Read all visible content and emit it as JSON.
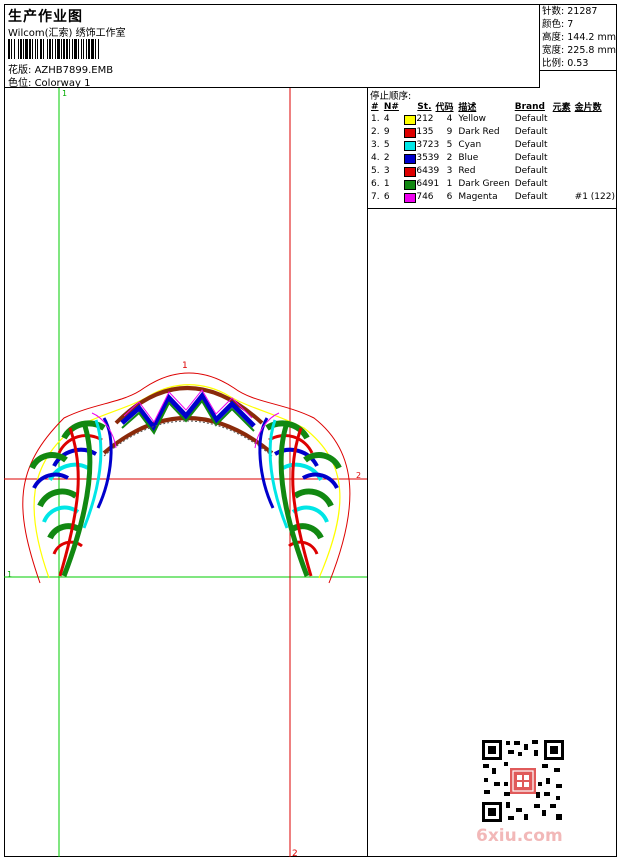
{
  "header": {
    "title": "生产作业图",
    "studio": "Wilcom(汇索) 绣饰工作室",
    "design_label": "花版:",
    "design_value": "AZHB7899.EMB",
    "colorway_label": "色位:",
    "colorway_value": "Colorway 1"
  },
  "stats": {
    "stitches_label": "针数:",
    "stitches": "21287",
    "colors_label": "颜色:",
    "colors": "7",
    "height_label": "高度:",
    "height": "144.2 mm",
    "width_label": "宽度:",
    "width": "225.8 mm",
    "scale_label": "比例:",
    "scale": "0.53"
  },
  "stop_sequence": {
    "title": "停止顺序:",
    "columns": [
      "#",
      "N#",
      "St.",
      "代码",
      "描述",
      "Brand",
      "元素",
      "金片数"
    ],
    "rows": [
      {
        "idx": "1.",
        "n": "4",
        "color": "#ffff00",
        "st": "212",
        "code": "4",
        "desc": "Yellow",
        "brand": "Default",
        "elem": "",
        "seq": ""
      },
      {
        "idx": "2.",
        "n": "9",
        "color": "#dd0000",
        "st": "135",
        "code": "9",
        "desc": "Dark Red",
        "brand": "Default",
        "elem": "",
        "seq": ""
      },
      {
        "idx": "3.",
        "n": "5",
        "color": "#00e6e6",
        "st": "3723",
        "code": "5",
        "desc": "Cyan",
        "brand": "Default",
        "elem": "",
        "seq": ""
      },
      {
        "idx": "4.",
        "n": "2",
        "color": "#0000cc",
        "st": "3539",
        "code": "2",
        "desc": "Blue",
        "brand": "Default",
        "elem": "",
        "seq": ""
      },
      {
        "idx": "5.",
        "n": "3",
        "color": "#dd0000",
        "st": "6439",
        "code": "3",
        "desc": "Red",
        "brand": "Default",
        "elem": "",
        "seq": ""
      },
      {
        "idx": "6.",
        "n": "1",
        "color": "#118811",
        "st": "6491",
        "code": "1",
        "desc": "Dark Green",
        "brand": "Default",
        "elem": "",
        "seq": ""
      },
      {
        "idx": "7.",
        "n": "6",
        "color": "#ee00ee",
        "st": "746",
        "code": "6",
        "desc": "Magenta",
        "brand": "Default",
        "elem": "",
        "seq": "#1 (122)"
      }
    ]
  },
  "canvas_markers": {
    "top_green": "1",
    "left_green": "1",
    "bottom_red": "2",
    "right_red": "2",
    "design_top": "1"
  },
  "watermark": "6xiu.com",
  "colors": {
    "guide_green": "#00cc00",
    "guide_red": "#dd0000"
  }
}
